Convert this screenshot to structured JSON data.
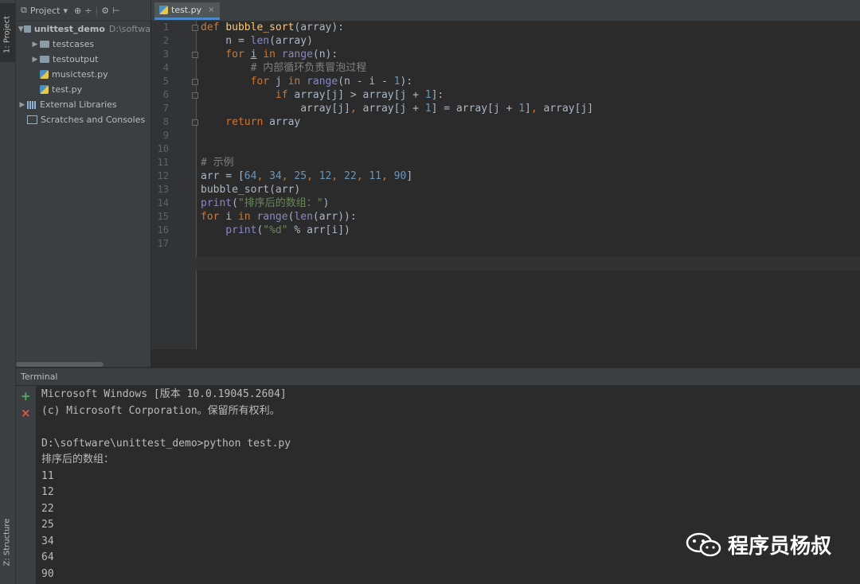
{
  "sidebar_strip": {
    "project_tab": "1: Project",
    "structure_tab": "Z: Structure"
  },
  "project_panel": {
    "title": "Project",
    "title_arrow": "▾",
    "toolbar_icons": [
      "target-icon",
      "collapse-icon",
      "gear-icon",
      "hide-icon"
    ],
    "tree": [
      {
        "label": "unittest_demo",
        "path": "D:\\softwa",
        "type": "project-root",
        "expanded": true,
        "indent": 0
      },
      {
        "label": "testcases",
        "type": "folder",
        "expanded": false,
        "indent": 1
      },
      {
        "label": "testoutput",
        "type": "folder",
        "expanded": false,
        "indent": 1
      },
      {
        "label": "musictest.py",
        "type": "python-file",
        "indent": 1
      },
      {
        "label": "test.py",
        "type": "python-file",
        "indent": 1
      },
      {
        "label": "External Libraries",
        "type": "library",
        "expanded": false,
        "indent": 0
      },
      {
        "label": "Scratches and Consoles",
        "type": "scratch",
        "indent": 0
      }
    ]
  },
  "editor": {
    "tab": {
      "label": "test.py",
      "close": "×"
    },
    "line_numbers": [
      "1",
      "2",
      "3",
      "4",
      "5",
      "6",
      "7",
      "8",
      "9",
      "10",
      "11",
      "12",
      "13",
      "14",
      "15",
      "16",
      "17"
    ],
    "current_line": "17",
    "code": [
      [
        [
          "kw",
          "def "
        ],
        [
          "fn",
          "bubble_sort"
        ],
        [
          "txt",
          "(array):"
        ]
      ],
      [
        [
          "txt",
          "    n = "
        ],
        [
          "bi",
          "len"
        ],
        [
          "txt",
          "(array)"
        ]
      ],
      [
        [
          "kw",
          "    for "
        ],
        [
          "ul",
          "i"
        ],
        [
          "kw",
          " in "
        ],
        [
          "bi",
          "range"
        ],
        [
          "txt",
          "(n):"
        ]
      ],
      [
        [
          "cm",
          "        # 内部循环负责冒泡过程"
        ]
      ],
      [
        [
          "kw",
          "        for "
        ],
        [
          "txt",
          "j "
        ],
        [
          "kw",
          "in "
        ],
        [
          "bi",
          "range"
        ],
        [
          "txt",
          "(n - i - "
        ],
        [
          "num",
          "1"
        ],
        [
          "txt",
          "):"
        ]
      ],
      [
        [
          "kw",
          "            if "
        ],
        [
          "txt",
          "array[j] > array[j + "
        ],
        [
          "num",
          "1"
        ],
        [
          "txt",
          "]:"
        ]
      ],
      [
        [
          "txt",
          "                array[j]"
        ],
        [
          "kw",
          ", "
        ],
        [
          "txt",
          "array[j + "
        ],
        [
          "num",
          "1"
        ],
        [
          "txt",
          "] = array[j + "
        ],
        [
          "num",
          "1"
        ],
        [
          "txt",
          "]"
        ],
        [
          "kw",
          ", "
        ],
        [
          "txt",
          "array[j]"
        ]
      ],
      [
        [
          "kw",
          "    return "
        ],
        [
          "txt",
          "array"
        ]
      ],
      [],
      [],
      [
        [
          "cm",
          "# 示例"
        ]
      ],
      [
        [
          "txt",
          "arr = ["
        ],
        [
          "num",
          "64"
        ],
        [
          "kw",
          ", "
        ],
        [
          "num",
          "34"
        ],
        [
          "kw",
          ", "
        ],
        [
          "num",
          "25"
        ],
        [
          "kw",
          ", "
        ],
        [
          "num",
          "12"
        ],
        [
          "kw",
          ", "
        ],
        [
          "num",
          "22"
        ],
        [
          "kw",
          ", "
        ],
        [
          "num",
          "11"
        ],
        [
          "kw",
          ", "
        ],
        [
          "num",
          "90"
        ],
        [
          "txt",
          "]"
        ]
      ],
      [
        [
          "txt",
          "bubble_sort(arr)"
        ]
      ],
      [
        [
          "bi",
          "print"
        ],
        [
          "txt",
          "("
        ],
        [
          "str",
          "\"排序后的数组：\""
        ],
        [
          "txt",
          ")"
        ]
      ],
      [
        [
          "kw",
          "for "
        ],
        [
          "txt",
          "i "
        ],
        [
          "kw",
          "in "
        ],
        [
          "bi",
          "range"
        ],
        [
          "txt",
          "("
        ],
        [
          "bi",
          "len"
        ],
        [
          "txt",
          "(arr)):"
        ]
      ],
      [
        [
          "bi",
          "    print"
        ],
        [
          "txt",
          "("
        ],
        [
          "str",
          "\"%d\""
        ],
        [
          "txt",
          " % arr[i])"
        ]
      ],
      []
    ]
  },
  "terminal": {
    "title": "Terminal",
    "add_button": "+",
    "close_button": "×",
    "lines": [
      "Microsoft Windows [版本 10.0.19045.2604]",
      "(c) Microsoft Corporation。保留所有权利。",
      "",
      "D:\\software\\unittest_demo>python test.py",
      "排序后的数组：",
      "11",
      "12",
      "22",
      "25",
      "34",
      "64",
      "90"
    ]
  },
  "watermark": {
    "text": "程序员杨叔",
    "icon": "wechat-icon"
  },
  "colors": {
    "keyword": "#cc7832",
    "function": "#ffc66d",
    "builtin": "#8888c6",
    "number": "#6897bb",
    "string": "#6a8759",
    "comment": "#808080",
    "text": "#a9b7c6",
    "add_green": "#59a869",
    "close_red": "#d9534f"
  }
}
